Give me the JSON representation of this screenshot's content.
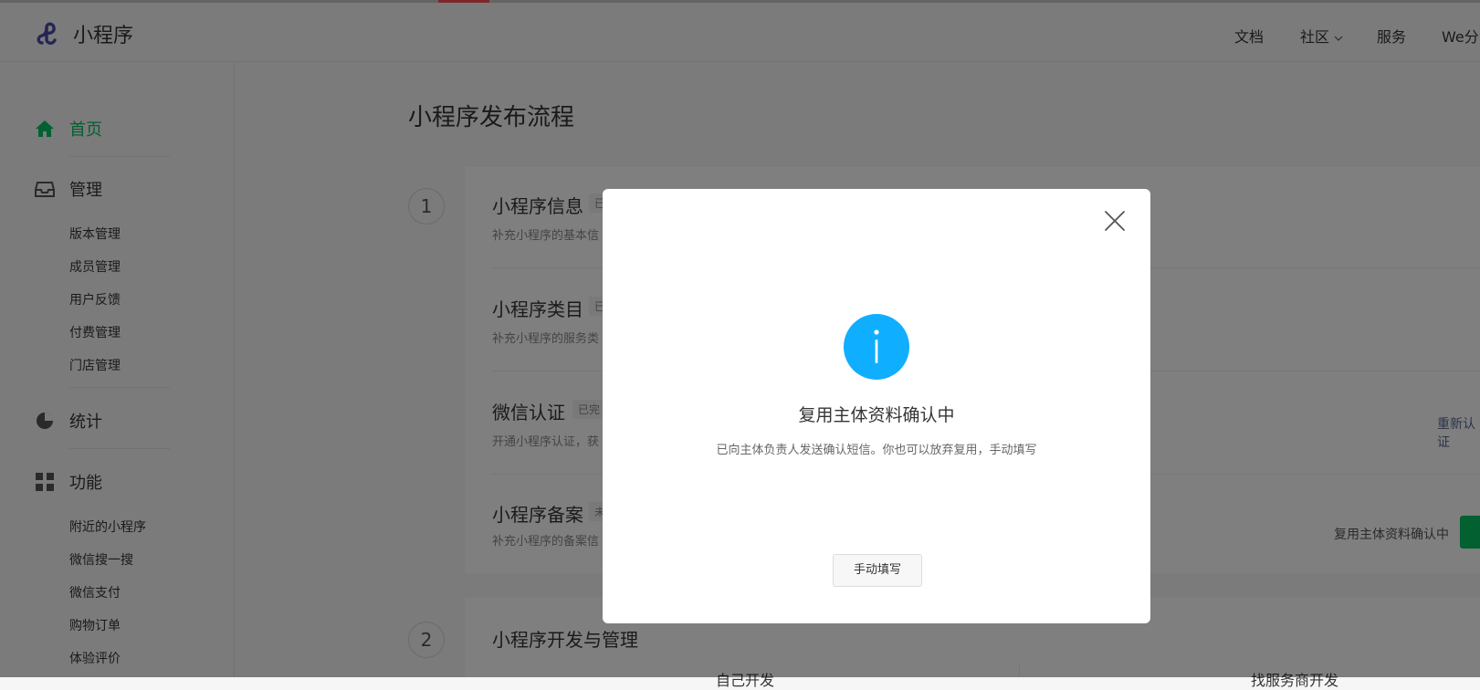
{
  "header": {
    "brand": "小程序",
    "nav": [
      "文档",
      "社区",
      "服务",
      "We分"
    ]
  },
  "sidebar": {
    "home": "首页",
    "manage": "管理",
    "manage_items": [
      "版本管理",
      "成员管理",
      "用户反馈",
      "付费管理",
      "门店管理"
    ],
    "stats": "统计",
    "features": "功能",
    "feature_items": [
      "附近的小程序",
      "微信搜一搜",
      "微信支付",
      "购物订单",
      "体验评价"
    ]
  },
  "main": {
    "page_title": "小程序发布流程",
    "step1_number": "1",
    "step2_number": "2",
    "items": [
      {
        "title": "小程序信息",
        "tag": "已",
        "desc": "补充小程序的基本信"
      },
      {
        "title": "小程序类目",
        "tag": "已",
        "desc": "补充小程序的服务类"
      },
      {
        "title": "微信认证",
        "tag": "已完",
        "desc": "开通小程序认证，获",
        "action": "重新认证"
      },
      {
        "title": "小程序备案",
        "tag": "未",
        "desc": "补充小程序的备案信",
        "status": "复用主体资料确认中"
      }
    ],
    "step2_title": "小程序开发与管理",
    "step2_col_left": "自己开发",
    "step2_col_right": "找服务商开发"
  },
  "modal": {
    "title": "复用主体资料确认中",
    "desc": "已向主体负责人发送确认短信。你也可以放弃复用，手动填写",
    "button": "手动填写"
  },
  "colors": {
    "brand_green": "#07c160",
    "info_blue": "#10aeff",
    "link_blue": "#576b95"
  },
  "icons": [
    "logo-icon",
    "home-icon",
    "inbox-icon",
    "pie-chart-icon",
    "grid-icon",
    "chevron-down-icon",
    "close-icon",
    "info-icon"
  ]
}
